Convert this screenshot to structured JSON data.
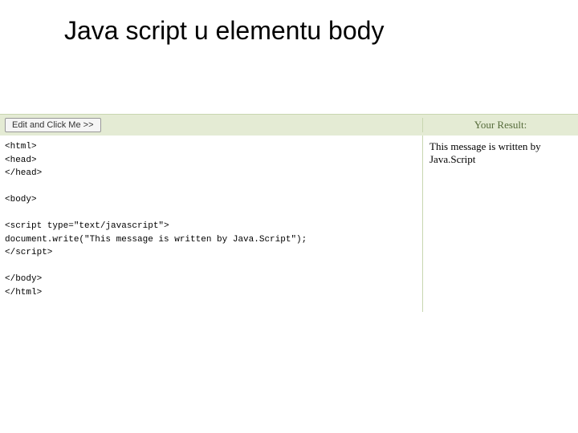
{
  "title": "Java script u elementu body",
  "editor": {
    "button_label": "Edit and Click Me >>",
    "result_label": "Your Result:",
    "code": "<html>\n<head>\n</head>\n\n<body>\n\n<script type=\"text/javascript\">\ndocument.write(\"This message is written by Java.Script\");\n</script>\n\n</body>\n</html>",
    "result_text": "This message is written by Java.Script"
  }
}
